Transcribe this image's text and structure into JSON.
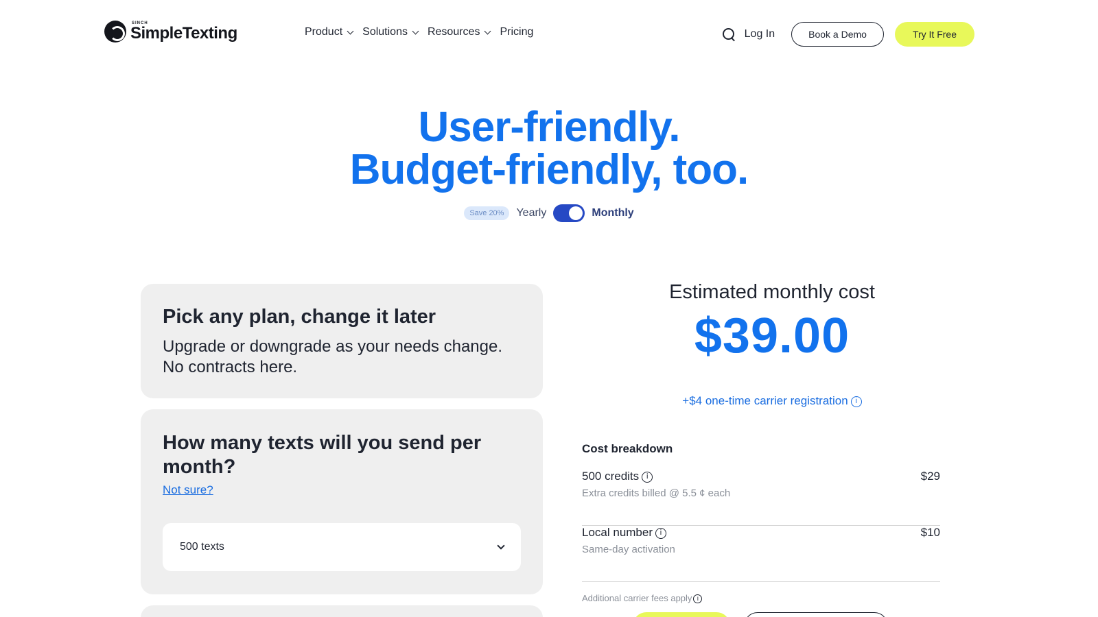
{
  "brand": {
    "small": "SINCH",
    "name": "SimpleTexting"
  },
  "nav": {
    "items": [
      {
        "label": "Product",
        "has_dropdown": true
      },
      {
        "label": "Solutions",
        "has_dropdown": true
      },
      {
        "label": "Resources",
        "has_dropdown": true
      },
      {
        "label": "Pricing",
        "has_dropdown": false
      }
    ],
    "login": "Log In",
    "demo": "Book a Demo",
    "try": "Try It Free"
  },
  "hero": {
    "line1": "User-friendly.",
    "line2": "Budget-friendly, too."
  },
  "billing": {
    "save_badge": "Save 20%",
    "yearly": "Yearly",
    "monthly": "Monthly",
    "selected": "Monthly"
  },
  "cards": {
    "plan": {
      "title": "Pick any plan, change it later",
      "line1": "Upgrade or downgrade as your needs change.",
      "line2": "No contracts here."
    },
    "texts": {
      "title": "How many texts will you send per month?",
      "link": "Not sure?",
      "selected": "500 texts"
    }
  },
  "estimate": {
    "label": "Estimated monthly cost",
    "price": "$39.00",
    "carrier": "+$4 one-time carrier registration",
    "info_icon": "ⓘ"
  },
  "breakdown": {
    "title": "Cost breakdown",
    "rows": [
      {
        "name": "500 credits",
        "sub": "Extra credits billed @ 5.5 ¢ each",
        "price": "$29"
      },
      {
        "name": "Local number",
        "sub": "Same-day activation",
        "price": "$10"
      }
    ],
    "fees": "Additional carrier fees apply"
  },
  "colors": {
    "accent": "#1272ed",
    "cta": "#e8f85a",
    "card_bg": "#efefef",
    "toggle": "#2649c4"
  }
}
